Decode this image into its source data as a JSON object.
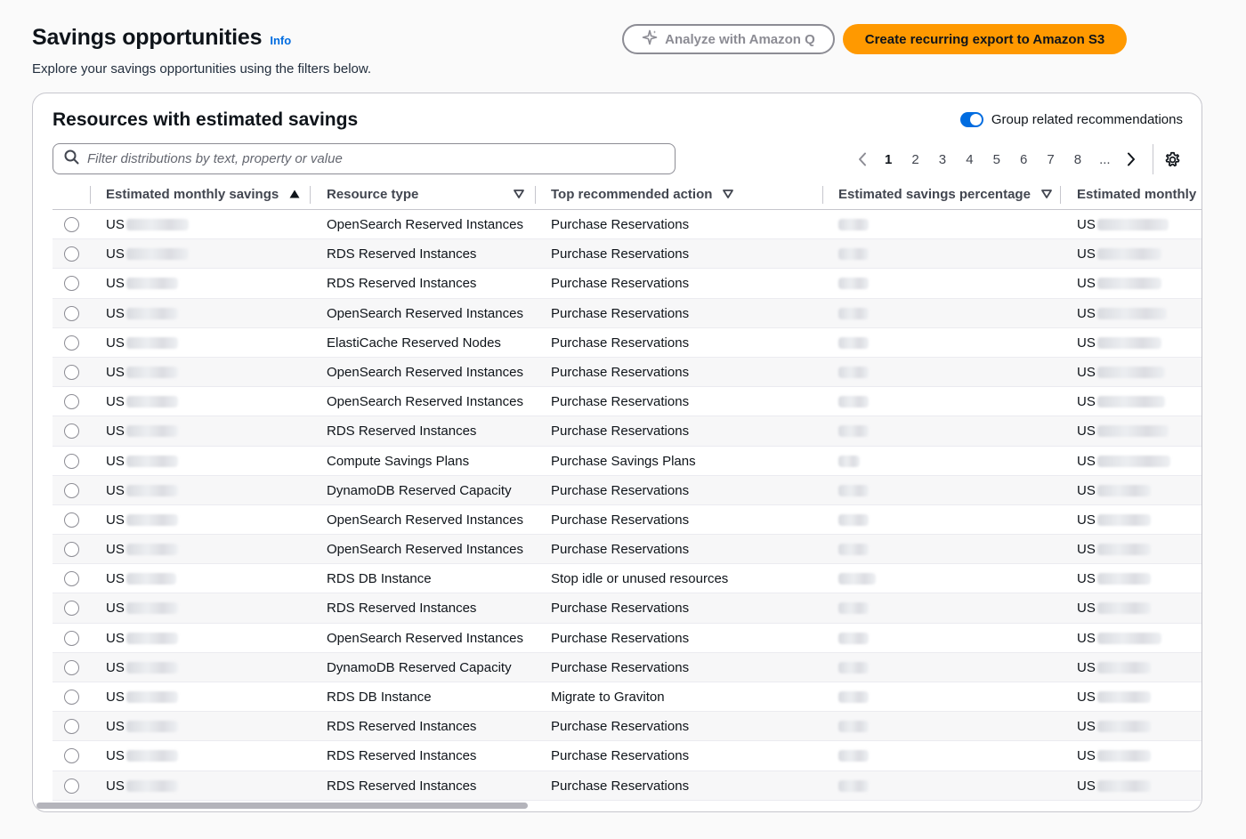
{
  "header": {
    "title": "Savings opportunities",
    "info": "Info",
    "subtitle": "Explore your savings opportunities using the filters below.",
    "analyze_button": "Analyze with Amazon Q",
    "export_button": "Create recurring export to Amazon S3"
  },
  "table": {
    "title": "Resources with estimated savings",
    "toggle_label": "Group related recommendations",
    "toggle_on": true,
    "filter_placeholder": "Filter distributions by text, property or value",
    "pagination": {
      "pages": [
        "1",
        "2",
        "3",
        "4",
        "5",
        "6",
        "7",
        "8",
        "..."
      ],
      "current": "1"
    },
    "columns": {
      "savings": "Estimated monthly savings",
      "resource_type": "Resource type",
      "action": "Top recommended action",
      "percentage": "Estimated savings percentage",
      "monthly_cost": "Estimated monthly"
    },
    "sort_column": "savings",
    "sort_direction": "ascending",
    "rows": [
      {
        "currency": "US",
        "resource_type": "OpenSearch Reserved Instances",
        "action": "Purchase Reservations"
      },
      {
        "currency": "US",
        "resource_type": "RDS Reserved Instances",
        "action": "Purchase Reservations"
      },
      {
        "currency": "US",
        "resource_type": "RDS Reserved Instances",
        "action": "Purchase Reservations"
      },
      {
        "currency": "US",
        "resource_type": "OpenSearch Reserved Instances",
        "action": "Purchase Reservations"
      },
      {
        "currency": "US",
        "resource_type": "ElastiCache Reserved Nodes",
        "action": "Purchase Reservations"
      },
      {
        "currency": "US",
        "resource_type": "OpenSearch Reserved Instances",
        "action": "Purchase Reservations"
      },
      {
        "currency": "US",
        "resource_type": "OpenSearch Reserved Instances",
        "action": "Purchase Reservations"
      },
      {
        "currency": "US",
        "resource_type": "RDS Reserved Instances",
        "action": "Purchase Reservations"
      },
      {
        "currency": "US",
        "resource_type": "Compute Savings Plans",
        "action": "Purchase Savings Plans"
      },
      {
        "currency": "US",
        "resource_type": "DynamoDB Reserved Capacity",
        "action": "Purchase Reservations"
      },
      {
        "currency": "US",
        "resource_type": "OpenSearch Reserved Instances",
        "action": "Purchase Reservations"
      },
      {
        "currency": "US",
        "resource_type": "OpenSearch Reserved Instances",
        "action": "Purchase Reservations"
      },
      {
        "currency": "US",
        "resource_type": "RDS DB Instance",
        "action": "Stop idle or unused resources"
      },
      {
        "currency": "US",
        "resource_type": "RDS Reserved Instances",
        "action": "Purchase Reservations"
      },
      {
        "currency": "US",
        "resource_type": "OpenSearch Reserved Instances",
        "action": "Purchase Reservations"
      },
      {
        "currency": "US",
        "resource_type": "DynamoDB Reserved Capacity",
        "action": "Purchase Reservations"
      },
      {
        "currency": "US",
        "resource_type": "RDS DB Instance",
        "action": "Migrate to Graviton"
      },
      {
        "currency": "US",
        "resource_type": "RDS Reserved Instances",
        "action": "Purchase Reservations"
      },
      {
        "currency": "US",
        "resource_type": "RDS Reserved Instances",
        "action": "Purchase Reservations"
      },
      {
        "currency": "US",
        "resource_type": "RDS Reserved Instances",
        "action": "Purchase Reservations"
      }
    ]
  },
  "colors": {
    "primary": "#006ce0",
    "accent": "#ff9900",
    "text": "#0f141a"
  },
  "icons": [
    "sparkle-icon",
    "search-icon",
    "chevron-left-icon",
    "chevron-right-icon",
    "gear-icon",
    "sort-ascending-icon",
    "sort-filter-icon"
  ]
}
